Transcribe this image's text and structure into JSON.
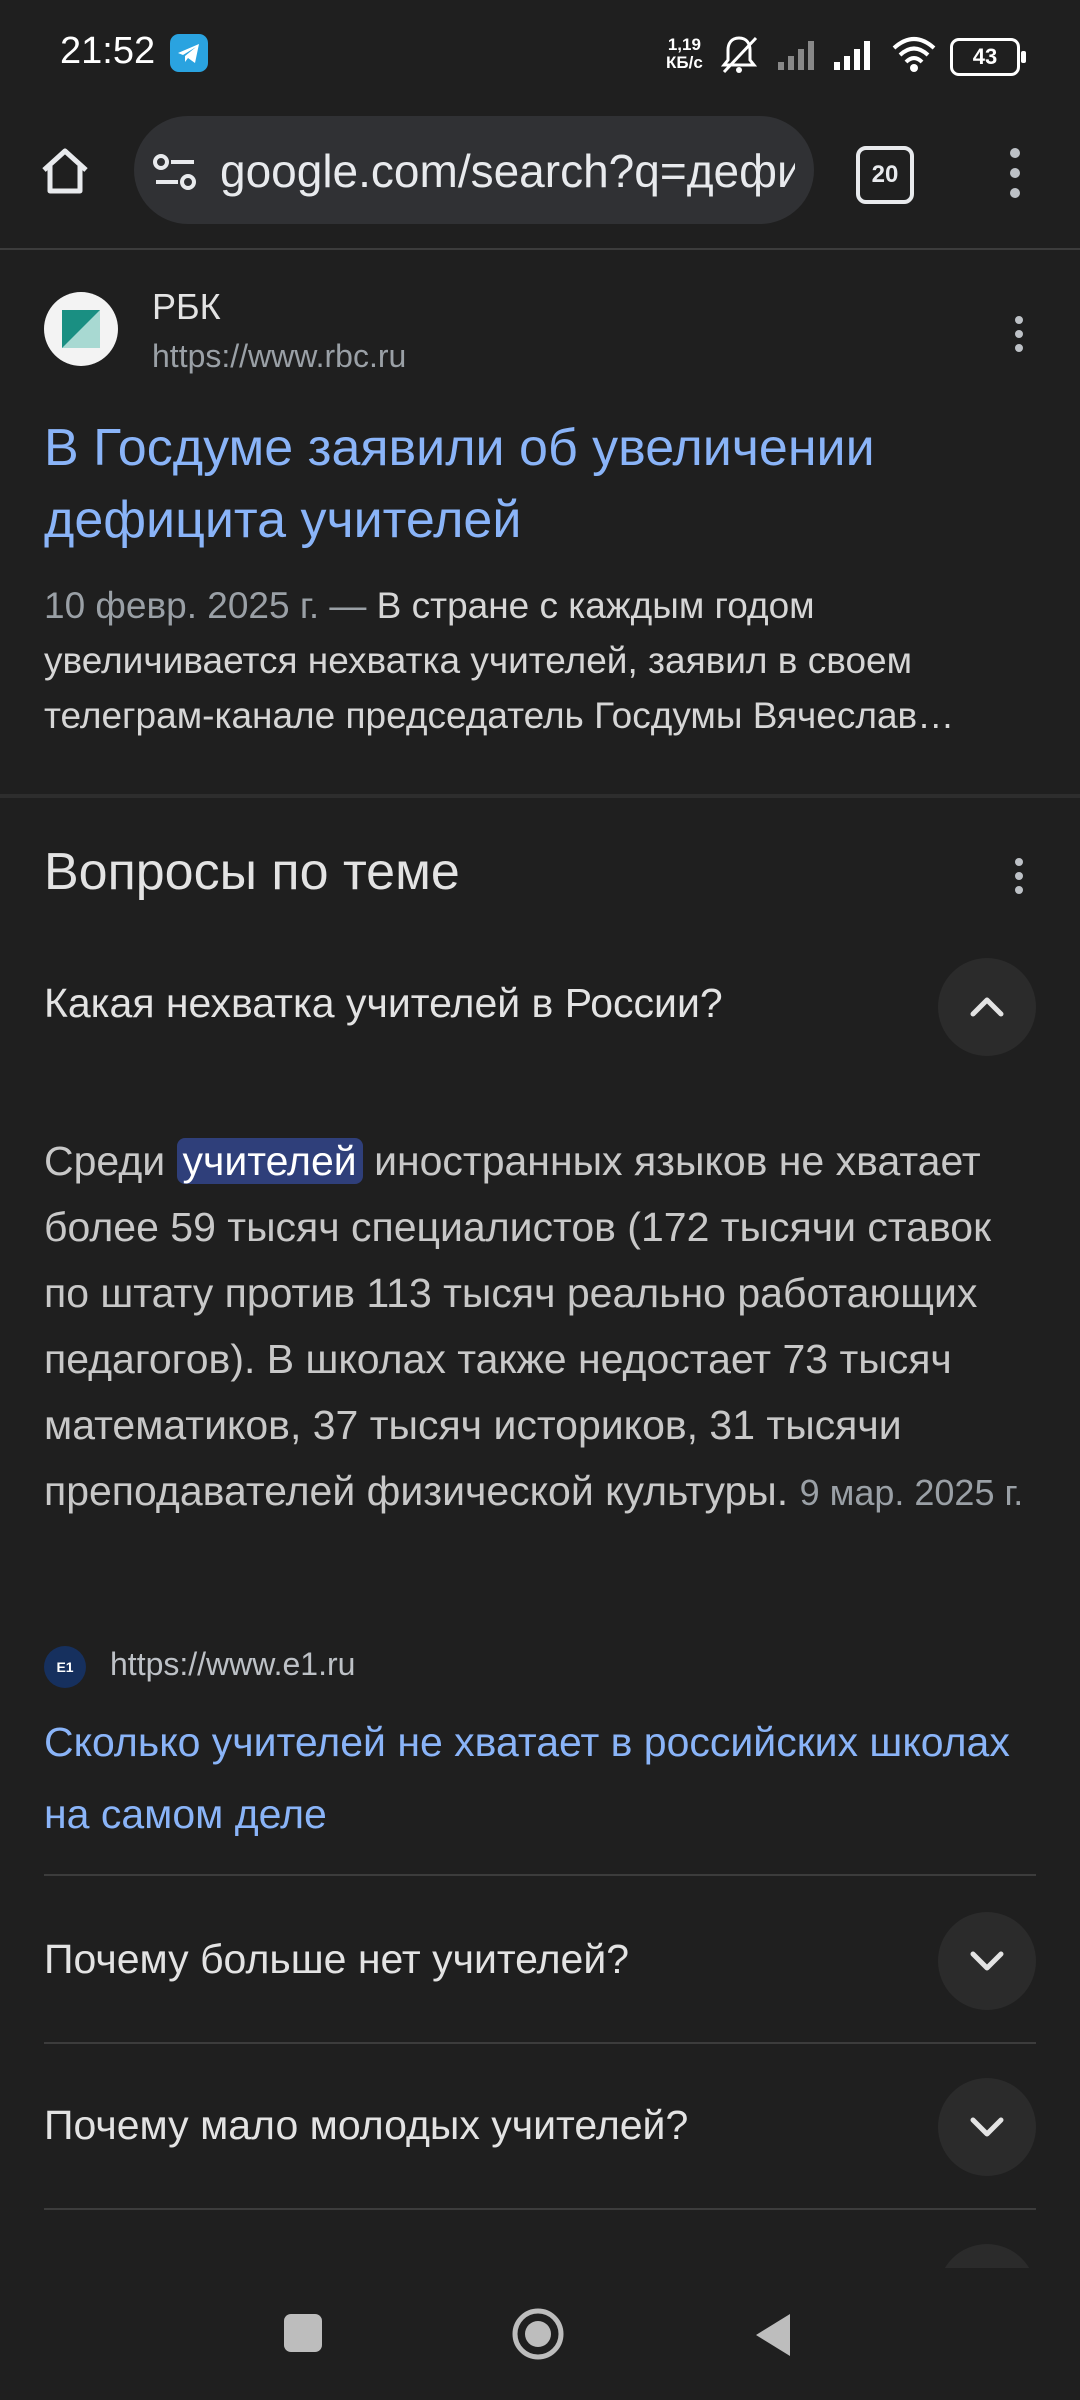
{
  "status_bar": {
    "time": "21:52",
    "net_speed_value": "1,19",
    "net_speed_unit": "КБ/с",
    "battery": "43",
    "icons": [
      "telegram-icon",
      "mute-icon",
      "signal-icon",
      "signal-icon",
      "wifi-icon",
      "battery-icon"
    ]
  },
  "browser": {
    "url": "google.com/search?q=дефиц",
    "tab_count": "20",
    "icons": [
      "home-icon",
      "site-settings-icon",
      "tabs-icon",
      "menu-icon"
    ]
  },
  "result": {
    "site_name": "РБК",
    "site_url": "https://www.rbc.ru",
    "title": "В Госдуме заявили об увеличении дефицита учителей",
    "date": "10 февр. 2025 г. —",
    "snippet": "В стране с каждым годом увеличивается нехватка учителей, заявил в своем телеграм-канале председатель Госдумы Вячеслав…"
  },
  "questions_section": {
    "title": "Вопросы по теме",
    "expanded": {
      "question": "Какая нехватка учителей в России?",
      "answer_before": "Среди ",
      "answer_highlight": "учителей",
      "answer_after": " иностранных языков не хватает более 59 тысяч специалистов (172 тысячи ставок по штату против 113 тысяч реально работающих педагогов). В школах также недостает 73 тысяч математиков, 37 тысяч историков, 31 тысячи преподавателей физической культуры.",
      "answer_date": "9 мар. 2025 г.",
      "source_icon": "E1",
      "source_url": "https://www.e1.ru",
      "source_title": "Сколько учителей не хватает в российских школах на самом деле"
    },
    "collapsed": [
      "Почему больше нет учителей?",
      "Почему мало молодых учителей?"
    ]
  },
  "colors": {
    "background": "#1f1f1f",
    "link": "#8ab4f8",
    "highlight": "#2f3f7a"
  }
}
